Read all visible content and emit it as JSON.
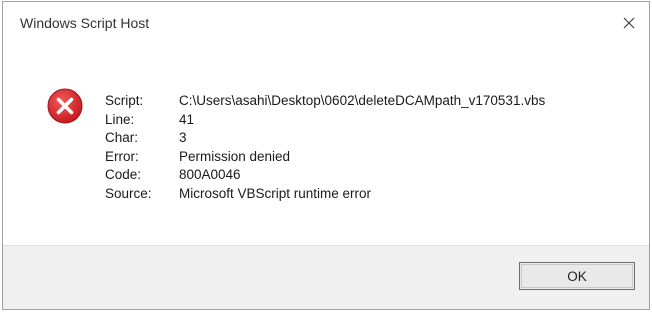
{
  "window": {
    "title": "Windows Script Host",
    "close_icon": "close-icon"
  },
  "error": {
    "icon": "error-icon",
    "icon_color": "#d82a2f",
    "fields": [
      {
        "label": "Script:",
        "value": "C:\\Users\\asahi\\Desktop\\0602\\deleteDCAMpath_v170531.vbs"
      },
      {
        "label": "Line:",
        "value": "41"
      },
      {
        "label": "Char:",
        "value": "3"
      },
      {
        "label": "Error:",
        "value": "Permission denied"
      },
      {
        "label": "Code:",
        "value": "800A0046"
      },
      {
        "label": "Source:",
        "value": "Microsoft VBScript runtime error"
      }
    ]
  },
  "footer": {
    "ok_label": "OK"
  }
}
